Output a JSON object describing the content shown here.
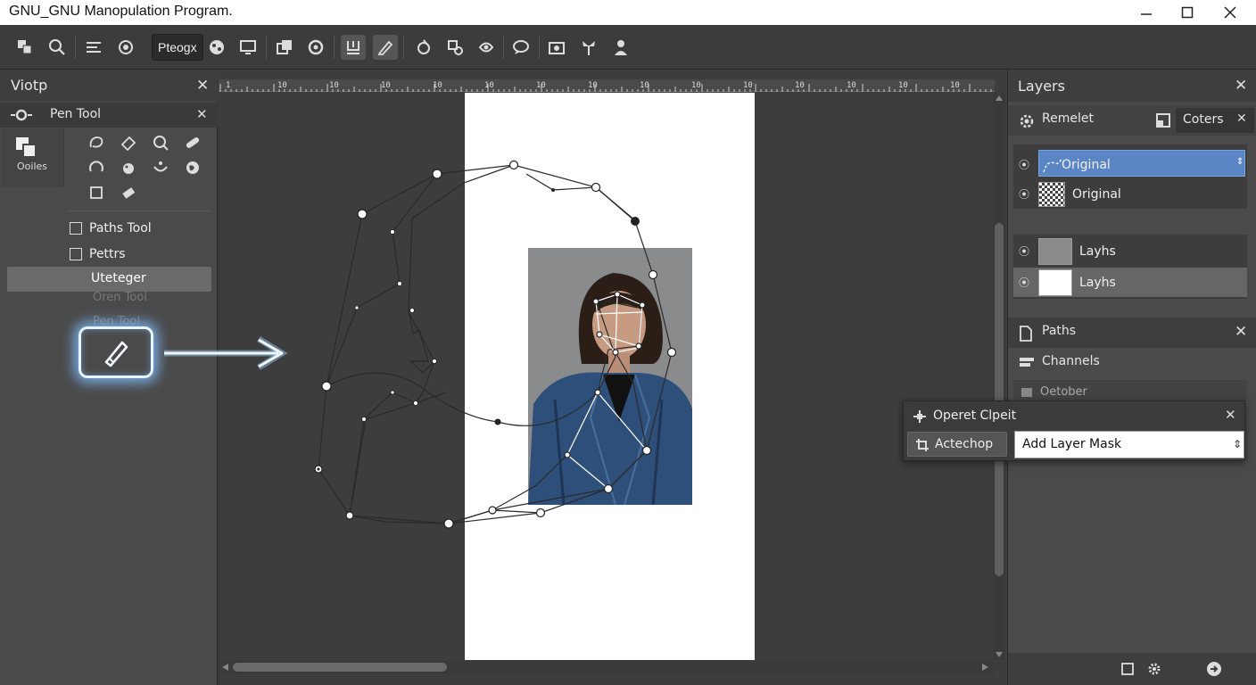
{
  "window": {
    "title": "GNU_GNU Manopulation Program."
  },
  "toolbar": {
    "text_button": "Pteogx"
  },
  "left_panel": {
    "title": "Viotp",
    "sub_title": "Pen Tool",
    "tools_label": "Ooiles",
    "items": [
      "Paths Tool",
      "Pettrs"
    ],
    "selected_item": "Uteteger",
    "ghost_items": [
      "Oren Tool",
      "Pen Tool"
    ]
  },
  "right_panel": {
    "title": "Layers",
    "remelet_label": "Remelet",
    "coters_tab": "Coters",
    "layers": [
      {
        "name": "Original",
        "selected": true
      },
      {
        "name": "Original",
        "selected": false
      },
      {
        "name": "Layhs",
        "selected": false
      },
      {
        "name": "Layhs",
        "selected": true
      }
    ],
    "paths_label": "Paths",
    "channels_label": "Channels",
    "ghost_label": "Oetober"
  },
  "popup": {
    "title": "Operet Clpeit",
    "button_label": "Actechop",
    "select_value": "Add Layer Mask"
  },
  "ruler": {
    "labels": [
      "1",
      "10",
      "10",
      "10",
      "10",
      "10",
      "10",
      "10",
      "10",
      "10",
      "10",
      "10",
      "10",
      "10",
      "10"
    ]
  },
  "colors": {
    "selection": "#5b86c5",
    "glow": "#82beff",
    "panel": "#4a4a4a",
    "canvas": "#3d3d3d"
  }
}
